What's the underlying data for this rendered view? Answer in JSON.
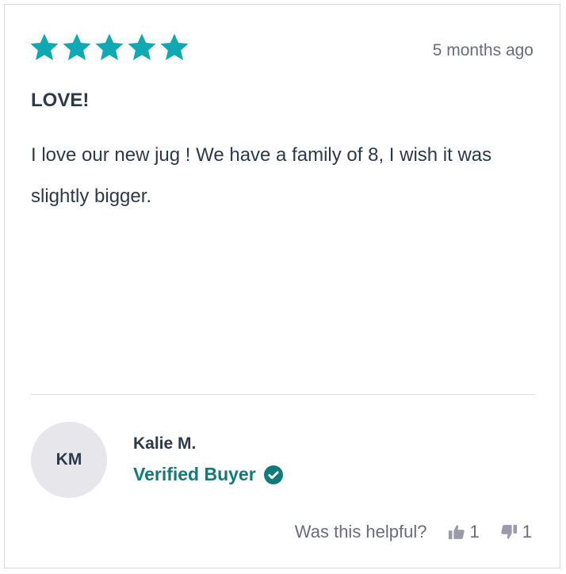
{
  "review": {
    "rating": 5,
    "rating_max": 5,
    "date": "5 months ago",
    "title": "LOVE!",
    "body": "I love our new jug ! We have a family of 8, I wish it was slightly bigger."
  },
  "author": {
    "initials": "KM",
    "name": "Kalie M.",
    "badge": "Verified Buyer"
  },
  "helpful": {
    "label": "Was this helpful?",
    "up_count": "1",
    "down_count": "1"
  },
  "colors": {
    "star": "#0fa9b4",
    "verified": "#127a7a",
    "text": "#2b3a4a",
    "muted": "#6b6b80",
    "thumb": "#9a9aac"
  },
  "icons": [
    "star-icon",
    "check-circle-icon",
    "thumbs-up-icon",
    "thumbs-down-icon"
  ]
}
